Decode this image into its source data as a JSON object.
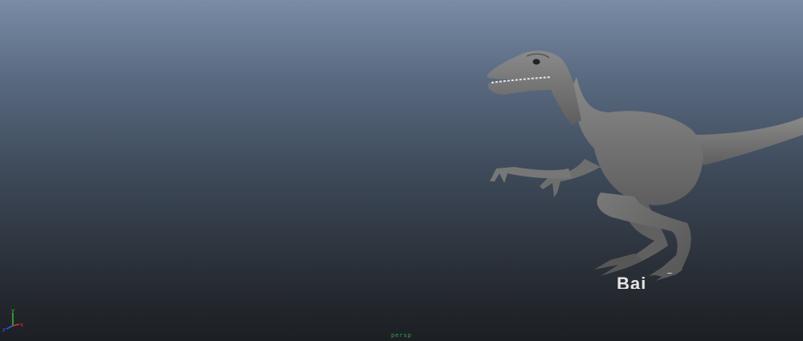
{
  "viewport": {
    "background_top": "#7a8ca6",
    "background_bottom": "#1c1f23",
    "model_name": "",
    "camera_label": "persp"
  },
  "axis_gizmo": {
    "x_label": "x",
    "y_label": "y",
    "z_label": "z",
    "x_color": "#e03030",
    "y_color": "#30c030",
    "z_color": "#3060ff"
  },
  "watermark": {
    "text": "Bai",
    "logo_icon": "paw-icon"
  },
  "colors": {
    "model_shade": "#808080",
    "camera_label": "#2fa84f"
  }
}
